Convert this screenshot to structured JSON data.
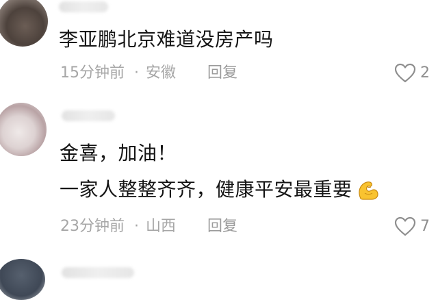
{
  "comments": [
    {
      "text": "李亚鹏北京难道没房产吗",
      "time": "15分钟前",
      "location": "安徽",
      "reply_label": "回复",
      "likes": "2"
    },
    {
      "lines": [
        "金喜，加油！",
        "一家人整整齐齐，健康平安最重要"
      ],
      "emoji": "flexed-biceps-emoji",
      "time": "23分钟前",
      "location": "山西",
      "reply_label": "回复",
      "likes": "7"
    }
  ],
  "separator": "·",
  "icons": {
    "like": "heart-outline-icon"
  },
  "colors": {
    "meta_text": "#a6a6a6",
    "body_text": "#141414",
    "background": "#ffffff"
  }
}
